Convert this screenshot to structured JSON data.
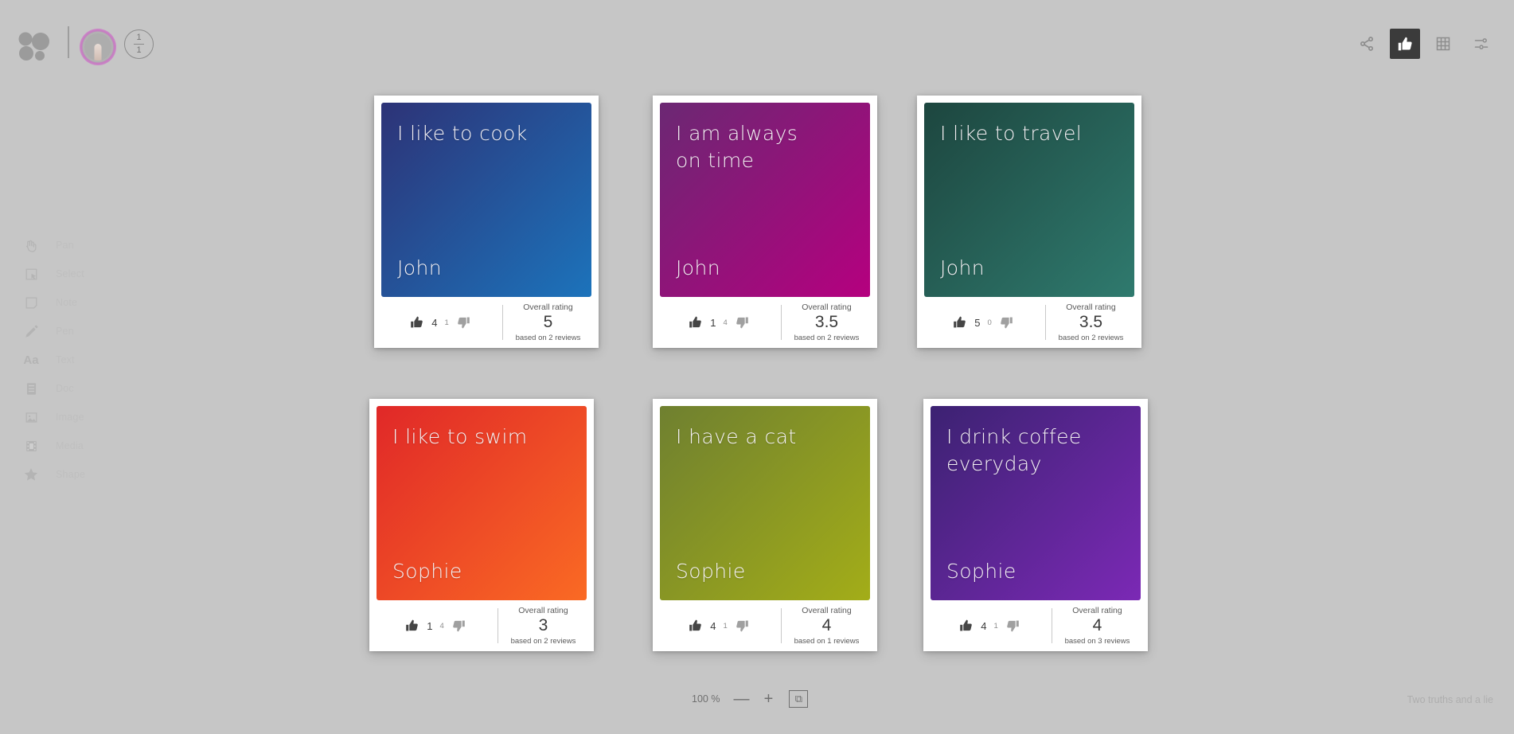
{
  "topbar": {
    "logo_icon": "app-logo-icon",
    "avatar_label": "user-avatar",
    "page_current": "1",
    "page_total": "1",
    "actions": [
      {
        "name": "share-icon",
        "label": "Share",
        "active": false
      },
      {
        "name": "thumbs-up-icon",
        "label": "Vote",
        "active": true
      },
      {
        "name": "grid-icon",
        "label": "Grid",
        "active": false
      },
      {
        "name": "settings-sliders-icon",
        "label": "Settings",
        "active": false
      }
    ]
  },
  "sidebar": {
    "items": [
      {
        "label": "Pan",
        "icon": "pan-hand-icon"
      },
      {
        "label": "Select",
        "icon": "select-cursor-icon"
      },
      {
        "label": "Note",
        "icon": "note-icon"
      },
      {
        "label": "Pen",
        "icon": "pen-icon"
      },
      {
        "label": "Text",
        "icon": "text-aa-icon"
      },
      {
        "label": "Doc",
        "icon": "doc-icon"
      },
      {
        "label": "Image",
        "icon": "image-icon"
      },
      {
        "label": "Media",
        "icon": "media-film-icon"
      },
      {
        "label": "Shape",
        "icon": "shape-star-icon"
      }
    ]
  },
  "board": {
    "title": "Two truths and a lie",
    "rating_label": "Overall rating",
    "cards": [
      {
        "statement": "I like to cook",
        "author": "John",
        "gradient_from": "#2d3377",
        "gradient_to": "#1c73bb",
        "up_votes": "4",
        "down_votes": "1",
        "rating": "5",
        "reviews_text": "based on 2 reviews"
      },
      {
        "statement": "I am always\non time",
        "author": "John",
        "gradient_from": "#6b2873",
        "gradient_to": "#b5007f",
        "up_votes": "1",
        "down_votes": "4",
        "rating": "3.5",
        "reviews_text": "based on 2 reviews"
      },
      {
        "statement": "I like to travel",
        "author": "John",
        "gradient_from": "#1d463f",
        "gradient_to": "#2f7a6e",
        "up_votes": "5",
        "down_votes": "0",
        "rating": "3.5",
        "reviews_text": "based on 2 reviews"
      },
      {
        "statement": "I like to swim",
        "author": "Sophie",
        "gradient_from": "#e02828",
        "gradient_to": "#fa6a24",
        "up_votes": "1",
        "down_votes": "4",
        "rating": "3",
        "reviews_text": "based on 2 reviews"
      },
      {
        "statement": "I have a cat",
        "author": "Sophie",
        "gradient_from": "#6f8030",
        "gradient_to": "#a3ad18",
        "up_votes": "4",
        "down_votes": "1",
        "rating": "4",
        "reviews_text": "based on 1 reviews"
      },
      {
        "statement": "I drink coffee\neveryday",
        "author": "Sophie",
        "gradient_from": "#3c2272",
        "gradient_to": "#7b29b5",
        "up_votes": "4",
        "down_votes": "1",
        "rating": "4",
        "reviews_text": "based on 3 reviews"
      }
    ]
  },
  "zoom": {
    "level": "100 %",
    "zoom_out_label": "—",
    "zoom_in_label": "+",
    "fit_label": "⧉"
  }
}
